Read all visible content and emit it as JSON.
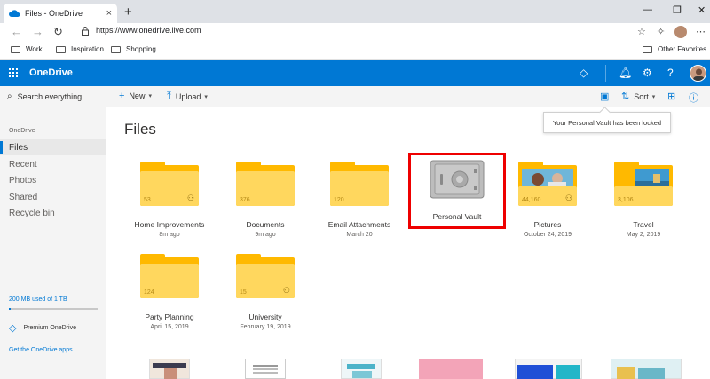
{
  "browser": {
    "tab_title": "Files - OneDrive",
    "tab_close": "×",
    "new_tab": "+",
    "url": "https://www.onedrive.live.com",
    "favorites": [
      "Work",
      "Inspiration",
      "Shopping"
    ],
    "other_favorites": "Other Favorites",
    "window_buttons": [
      "—",
      "❐",
      "✕"
    ],
    "nav": {
      "back": "←",
      "forward": "→",
      "refresh": "↻"
    }
  },
  "header": {
    "brand": "OneDrive"
  },
  "sidebar": {
    "search_placeholder": "Search everything",
    "section_label": "OneDrive",
    "items": [
      {
        "label": "Files",
        "active": true
      },
      {
        "label": "Recent"
      },
      {
        "label": "Photos"
      },
      {
        "label": "Shared"
      },
      {
        "label": "Recycle bin"
      }
    ],
    "storage_text": "200 MB used of 1 TB",
    "storage_fraction": 0.02,
    "premium": "Premium OneDrive",
    "get_apps": "Get the OneDrive apps"
  },
  "commandbar": {
    "new": "New",
    "upload": "Upload",
    "sort": "Sort"
  },
  "tooltip": "Your Personal Vault has been locked",
  "page_title": "Files",
  "tiles": [
    {
      "name": "Home Improvements",
      "date": "8m ago",
      "count": "53",
      "shared": true
    },
    {
      "name": "Documents",
      "date": "9m ago",
      "count": "376",
      "shared": false
    },
    {
      "name": "Email Attachments",
      "date": "March 20",
      "count": "120",
      "shared": false
    },
    {
      "name": "Personal Vault",
      "date": ""
    },
    {
      "name": "Pictures",
      "date": "October 24, 2019",
      "count": "44,160",
      "shared": true
    },
    {
      "name": "Travel",
      "date": "May 2, 2019",
      "count": "3,106",
      "shared": false
    },
    {
      "name": "Party Planning",
      "date": "April 15, 2019",
      "count": "124",
      "shared": false
    },
    {
      "name": "University",
      "date": "February 19, 2019",
      "count": "15",
      "shared": true
    }
  ],
  "colors": {
    "accent": "#0078d4",
    "folder_back": "#ffb900",
    "folder_front": "#ffd75e",
    "highlight": "#e00000"
  }
}
